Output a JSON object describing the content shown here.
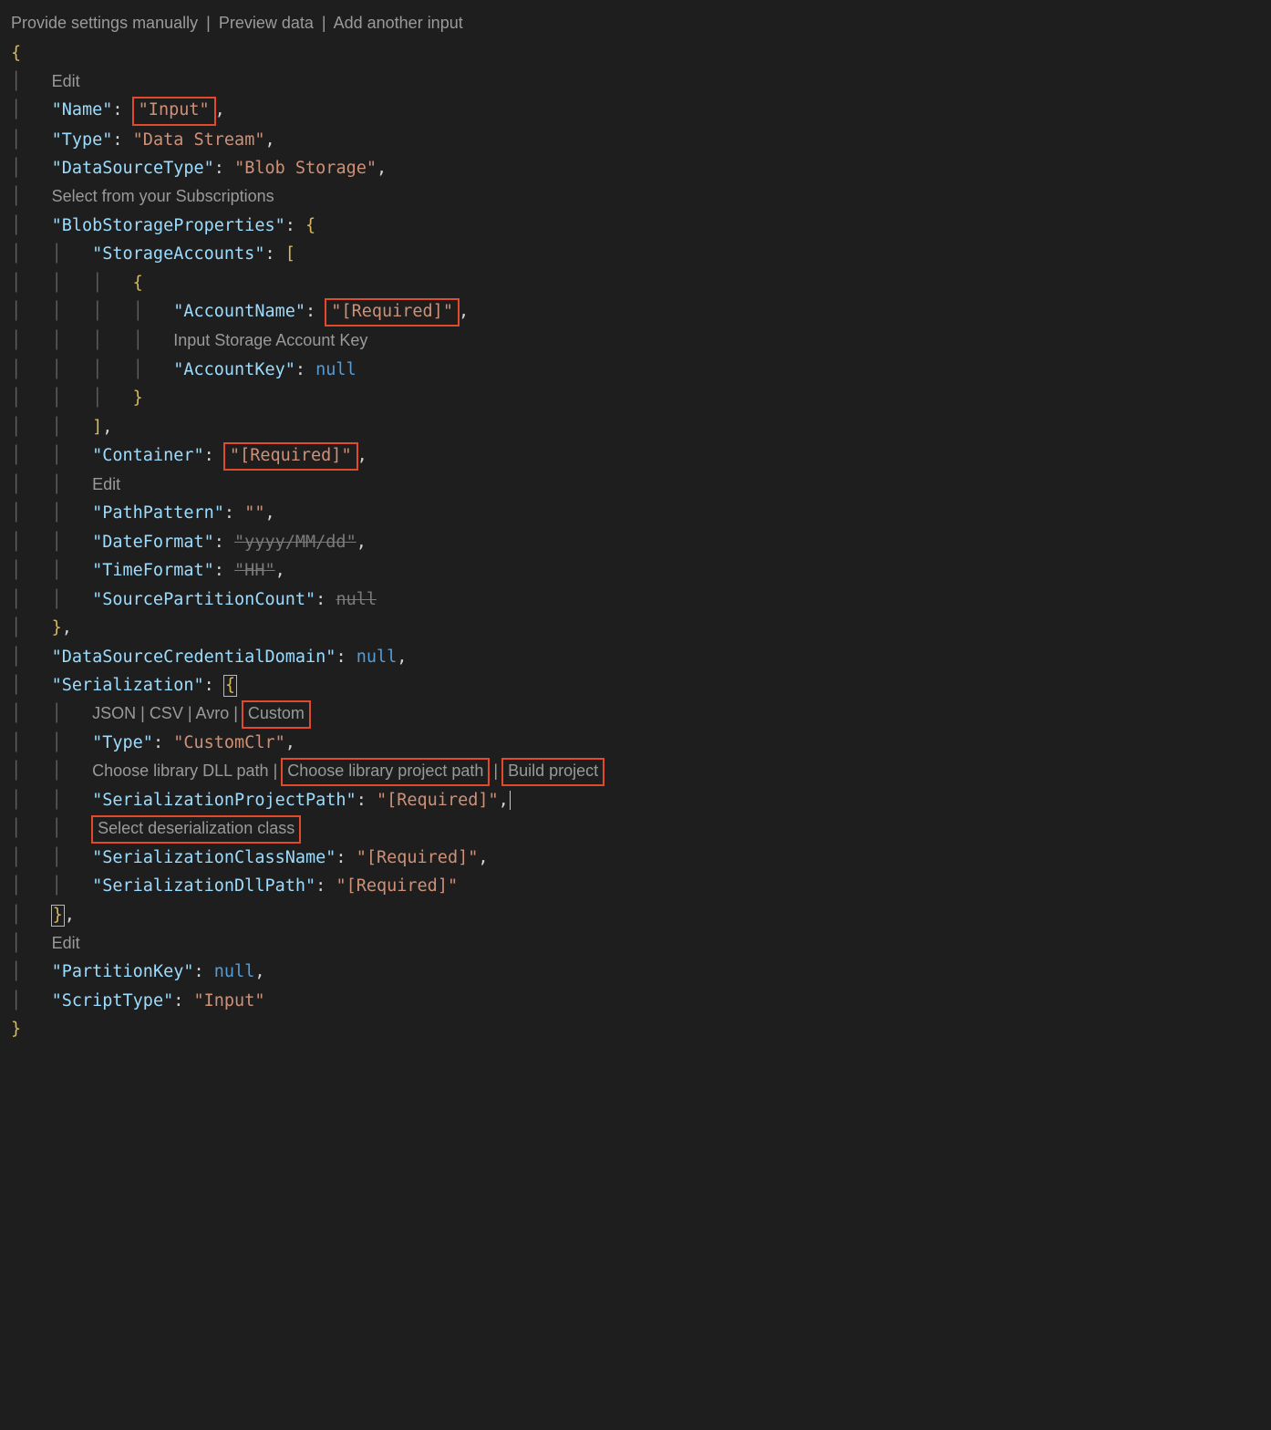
{
  "top": {
    "a": "Provide settings manually",
    "b": "Preview data",
    "c": "Add another input"
  },
  "hints": {
    "editTop": "Edit",
    "selectSubs": "Select from your Subscriptions",
    "acctKey": "Input Storage Account Key",
    "edit2": "Edit",
    "serialOpts": {
      "json": "JSON",
      "csv": "CSV",
      "avro": "Avro",
      "custom": "Custom"
    },
    "libOpts": {
      "dll": "Choose library DLL path",
      "proj": "Choose library project path",
      "build": "Build project"
    },
    "deser": "Select deserialization class",
    "editBottom": "Edit"
  },
  "json": {
    "nameK": "\"Name\"",
    "nameV": "\"Input\"",
    "typeK": "\"Type\"",
    "typeV": "\"Data Stream\"",
    "dstK": "\"DataSourceType\"",
    "dstV": "\"Blob Storage\"",
    "bspK": "\"BlobStorageProperties\"",
    "saK": "\"StorageAccounts\"",
    "anK": "\"AccountName\"",
    "anV": "\"[Required]\"",
    "akK": "\"AccountKey\"",
    "akV": "null",
    "contK": "\"Container\"",
    "contV": "\"[Required]\"",
    "ppK": "\"PathPattern\"",
    "ppV": "\"\"",
    "dfK": "\"DateFormat\"",
    "dfV": "\"yyyy/MM/dd\"",
    "tfK": "\"TimeFormat\"",
    "tfV": "\"HH\"",
    "spcK": "\"SourcePartitionCount\"",
    "spcV": "null",
    "dcdK": "\"DataSourceCredentialDomain\"",
    "dcdV": "null",
    "serK": "\"Serialization\"",
    "stypeK": "\"Type\"",
    "stypeV": "\"CustomClr\"",
    "sppK": "\"SerializationProjectPath\"",
    "sppV": "\"[Required]\"",
    "scnK": "\"SerializationClassName\"",
    "scnV": "\"[Required]\"",
    "sdpK": "\"SerializationDllPath\"",
    "sdpV": "\"[Required]\"",
    "pkK": "\"PartitionKey\"",
    "pkV": "null",
    "sctK": "\"ScriptType\"",
    "sctV": "\"Input\""
  }
}
